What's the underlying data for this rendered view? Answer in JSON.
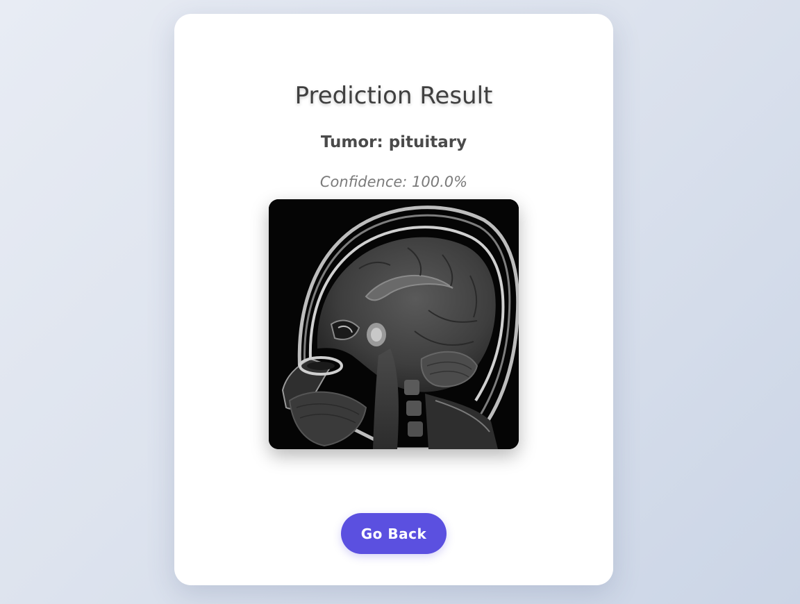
{
  "result": {
    "title": "Prediction Result",
    "tumor_label": "Tumor: pituitary",
    "confidence_label": "Confidence: 100.0%"
  },
  "scan": {
    "icon": "mri-brain-scan-image"
  },
  "actions": {
    "back_label": "Go Back"
  },
  "colors": {
    "accent": "#5b50e0",
    "card": "#ffffff",
    "title": "#3f3f3f",
    "subtitle": "#4a4a4a",
    "muted": "#7a7a7a"
  }
}
